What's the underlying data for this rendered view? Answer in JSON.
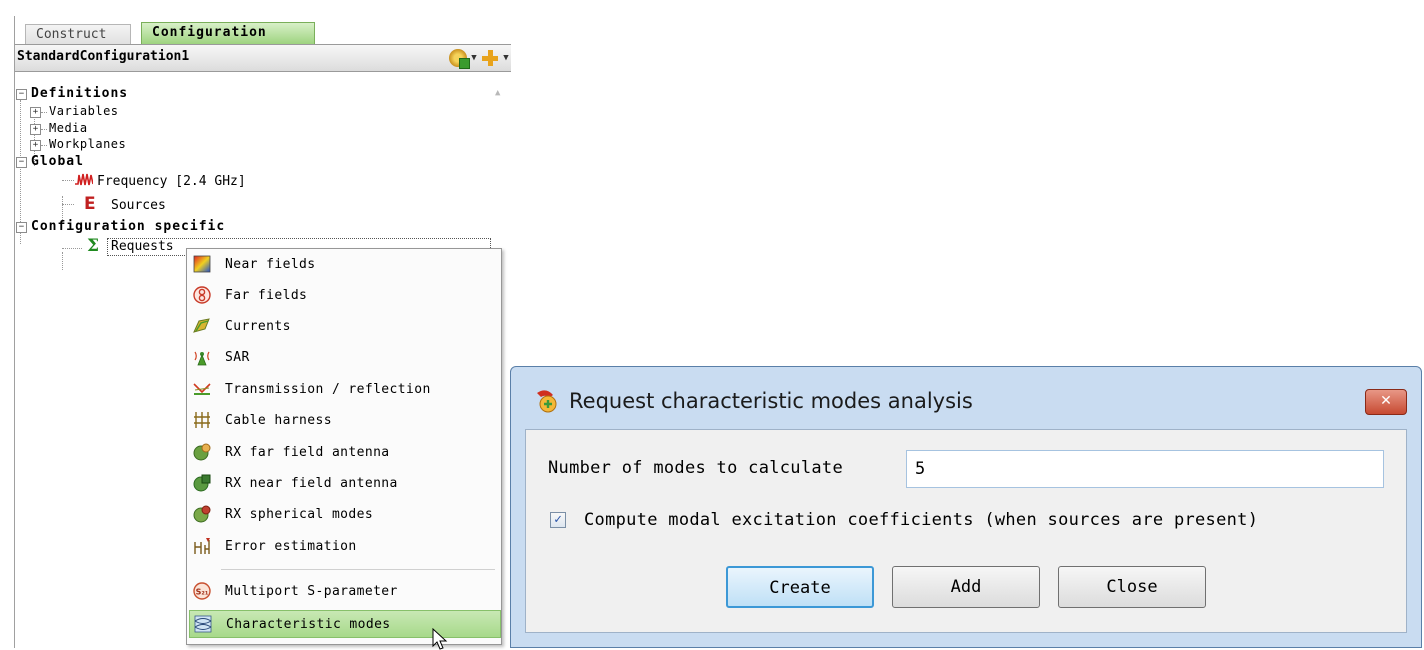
{
  "panel": {
    "tabs": [
      {
        "label": "Construct"
      },
      {
        "label": "Configuration"
      }
    ],
    "config_name": "StandardConfiguration1"
  },
  "tree": {
    "definitions": "Definitions",
    "variables": "Variables",
    "media": "Media",
    "workplanes": "Workplanes",
    "global": "Global",
    "frequency": "Frequency [2.4 GHz]",
    "sources": "Sources",
    "config_specific": "Configuration specific",
    "requests": "Requests"
  },
  "context_menu": {
    "items": [
      {
        "label": "Near fields",
        "icon": "near-fields-icon"
      },
      {
        "label": "Far fields",
        "icon": "far-fields-icon"
      },
      {
        "label": "Currents",
        "icon": "currents-icon"
      },
      {
        "label": "SAR",
        "icon": "sar-icon"
      },
      {
        "label": "Transmission / reflection",
        "icon": "transmission-icon"
      },
      {
        "label": "Cable harness",
        "icon": "cable-harness-icon"
      },
      {
        "label": "RX far field antenna",
        "icon": "rx-far-field-icon"
      },
      {
        "label": "RX near field antenna",
        "icon": "rx-near-field-icon"
      },
      {
        "label": "RX spherical modes",
        "icon": "rx-spherical-icon"
      },
      {
        "label": "Error estimation",
        "icon": "error-estimation-icon"
      },
      {
        "label": "Multiport S-parameter",
        "icon": "s-parameter-icon"
      },
      {
        "label": "Characteristic modes",
        "icon": "characteristic-modes-icon"
      }
    ],
    "highlighted": "Characteristic modes"
  },
  "dialog": {
    "title": "Request characteristic modes analysis",
    "close_glyph": "✕",
    "modes_label": "Number of modes to calculate",
    "modes_value": "5",
    "checkbox_checked": true,
    "checkbox_label": "Compute modal excitation coefficients (when sources are present)",
    "buttons": {
      "create": "Create",
      "add": "Add",
      "close": "Close"
    }
  },
  "colors": {
    "active_tab": "#9bd27c",
    "highlight": "#a7d98a",
    "dialog_frame": "#c9dcf1",
    "close_button": "#c74a32"
  }
}
